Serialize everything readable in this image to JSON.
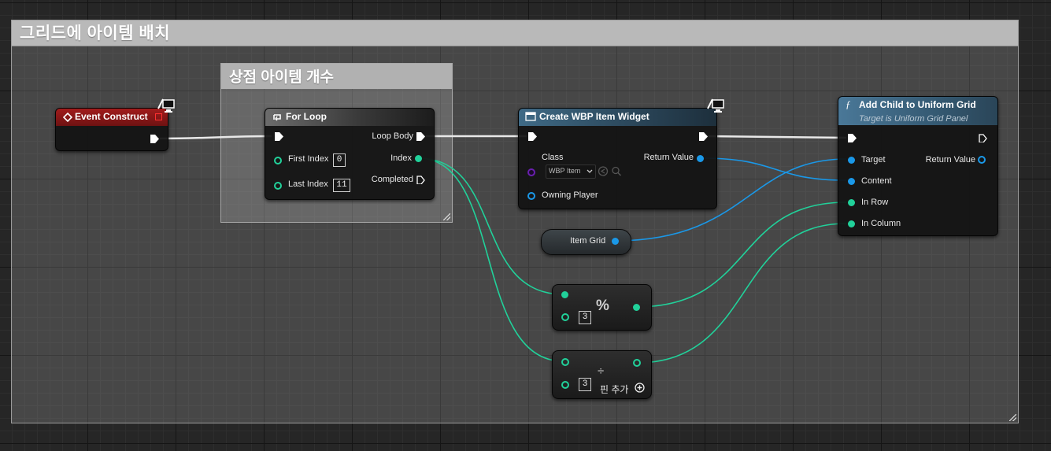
{
  "comments": {
    "outer_title": "그리드에 아이템 배치",
    "inner_title": "상점 아이템 개수"
  },
  "event_construct": {
    "title": "Event Construct"
  },
  "for_loop": {
    "title": "For Loop",
    "first_index_label": "First Index",
    "first_index_value": "0",
    "last_index_label": "Last Index",
    "last_index_value": "11",
    "loop_body_label": "Loop Body",
    "index_label": "Index",
    "completed_label": "Completed"
  },
  "create_widget": {
    "title": "Create WBP Item Widget",
    "class_label": "Class",
    "class_value": "WBP Item",
    "owning_player_label": "Owning Player",
    "return_value_label": "Return Value"
  },
  "add_child": {
    "title": "Add Child to Uniform Grid",
    "subtitle": "Target is Uniform Grid Panel",
    "target_label": "Target",
    "content_label": "Content",
    "in_row_label": "In Row",
    "in_column_label": "In Column",
    "return_value_label": "Return Value"
  },
  "item_grid": {
    "label": "Item Grid"
  },
  "modulo_node": {
    "symbol": "%",
    "value": "3"
  },
  "divide_node": {
    "symbol": "÷",
    "value": "3",
    "add_pin_label": "핀 추가"
  },
  "colors": {
    "exec": "#ffffff",
    "integer": "#21d19a",
    "object": "#1a98e8",
    "class": "#6a1fb0",
    "event_header": "#8b1a1a",
    "function_header": "#3a5f78"
  }
}
